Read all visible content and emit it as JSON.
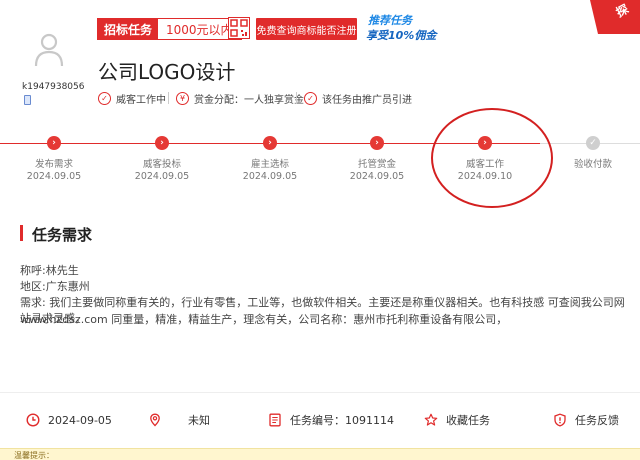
{
  "user": {
    "name": "k1947938056"
  },
  "tags": {
    "category": "招标任务",
    "price": "1000元以内"
  },
  "free_button": "免费查询商标能否注册",
  "promo": {
    "line1": "推荐任务",
    "line2": "享受10%佣金"
  },
  "corner": "探",
  "title": "公司LOGO设计",
  "meta": {
    "status": "威客工作中",
    "reward": "赏金分配：一人独享赏金",
    "referral": "该任务由推广员引进"
  },
  "steps": [
    {
      "label": "发布需求",
      "date": "2024.09.05",
      "done": true
    },
    {
      "label": "威客投标",
      "date": "2024.09.05",
      "done": true
    },
    {
      "label": "雇主选标",
      "date": "2024.09.05",
      "done": true
    },
    {
      "label": "托管赏金",
      "date": "2024.09.05",
      "done": true
    },
    {
      "label": "威客工作",
      "date": "2024.09.10",
      "done": true
    },
    {
      "label": "验收付款",
      "date": "",
      "done": false
    }
  ],
  "requirement": {
    "heading": "任务需求",
    "lines": [
      "称呼:林先生",
      "地区:广东惠州",
      "需求: 我们主要做同称重有关的，行业有零售，工业等，也做软件相关。主要还是称重仪器相关。也有科技感 可查阅我公司网站寻求灵感，",
      "www.hzdsz.com 同重量，精准，精益生产，理念有关，公司名称：惠州市托利称重设备有限公司，"
    ]
  },
  "footer": {
    "date": "2024-09-05",
    "location": "未知",
    "task_no": "任务编号：1091114",
    "favorite": "收藏任务",
    "feedback": "任务反馈"
  },
  "bottom_notice": "温馨提示：",
  "colors": {
    "accent": "#e02b2b",
    "notice_bg": "#fff6cf"
  }
}
